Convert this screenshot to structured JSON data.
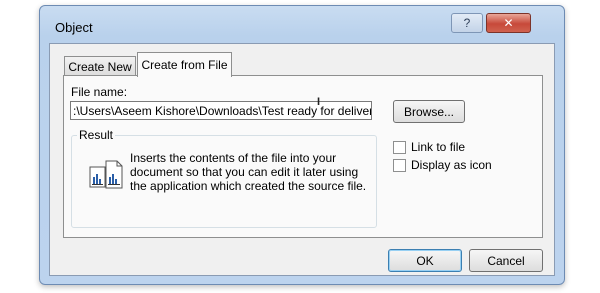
{
  "window": {
    "title": "Object",
    "help_label": "?",
    "close_label": "✕"
  },
  "tabs": [
    {
      "label": "Create New"
    },
    {
      "label": "Create from File"
    }
  ],
  "form": {
    "file_name_label": "File name:",
    "file_name_value": ":\\Users\\Aseem Kishore\\Downloads\\Test ready for delivery.docx",
    "browse_label": "Browse...",
    "result_label": "Result",
    "result_text": "Inserts the contents of the file into your document so that you can edit it later using the application which created the source file.",
    "link_to_file_label": "Link to file",
    "link_to_file_checked": false,
    "display_as_icon_label": "Display as icon",
    "display_as_icon_checked": false
  },
  "buttons": {
    "ok": "OK",
    "cancel": "Cancel"
  },
  "colors": {
    "titlebar": "#c9dcf1",
    "close_button": "#c7493a",
    "dialog_face": "#f0f0f0",
    "default_button_border": "#3c7fb1"
  }
}
